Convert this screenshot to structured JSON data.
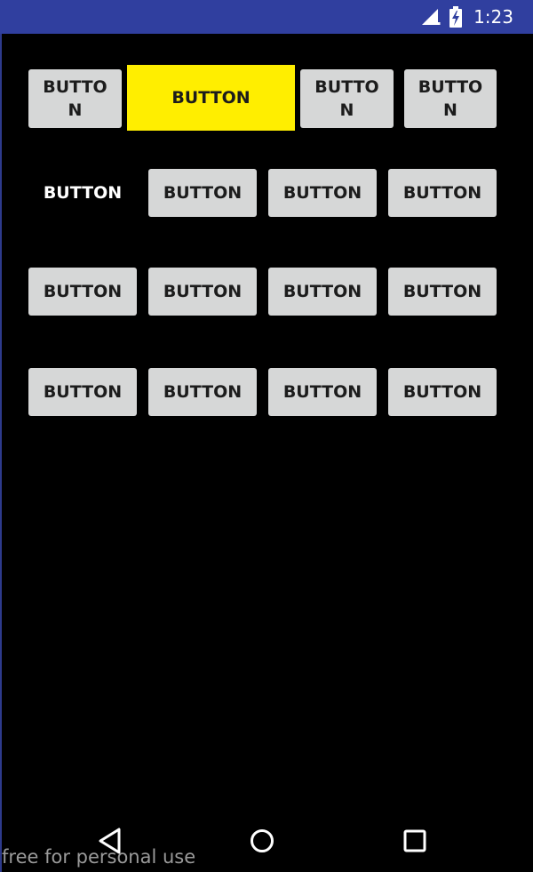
{
  "status_bar": {
    "time": "1:23",
    "icons": [
      "signal-icon",
      "battery-charging-icon"
    ],
    "background": "#303f9f"
  },
  "grid": {
    "row1": {
      "b1": "BUTTON",
      "b2": "BUTTON",
      "b3": "BUTTON",
      "b4": "BUTTON"
    },
    "row2": {
      "b1": "BUTTON",
      "b2": "BUTTON",
      "b3": "BUTTON",
      "b4": "BUTTON"
    },
    "row3": {
      "b1": "BUTTON",
      "b2": "BUTTON",
      "b3": "BUTTON",
      "b4": "BUTTON"
    },
    "row4": {
      "b1": "BUTTON",
      "b2": "BUTTON",
      "b3": "BUTTON",
      "b4": "BUTTON"
    }
  },
  "colors": {
    "button_bg": "#d6d7d7",
    "highlight": "#ffee00",
    "background": "#000000"
  },
  "nav_bar": {
    "icons": [
      "back-icon",
      "home-icon",
      "recents-icon"
    ]
  },
  "watermark": "free for personal use"
}
